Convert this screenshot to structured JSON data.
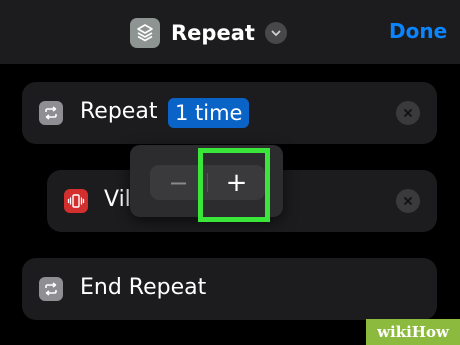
{
  "header": {
    "title": "Repeat",
    "done_label": "Done",
    "icon": "shortcut-layers-icon"
  },
  "actions": [
    {
      "label": "Repeat",
      "token": "1 time",
      "icon": "repeat-icon"
    },
    {
      "label": "Vil",
      "icon": "vibrate-icon"
    },
    {
      "label": "End Repeat",
      "icon": "repeat-icon"
    }
  ],
  "stepper": {
    "minus_label": "−",
    "plus_label": "+"
  },
  "watermark": {
    "text": "wikiHow"
  },
  "colors": {
    "accent": "#0a84ff",
    "token_bg": "#0a64c8",
    "highlight": "#39e639",
    "vibrate_icon_bg": "#d32f2f"
  }
}
